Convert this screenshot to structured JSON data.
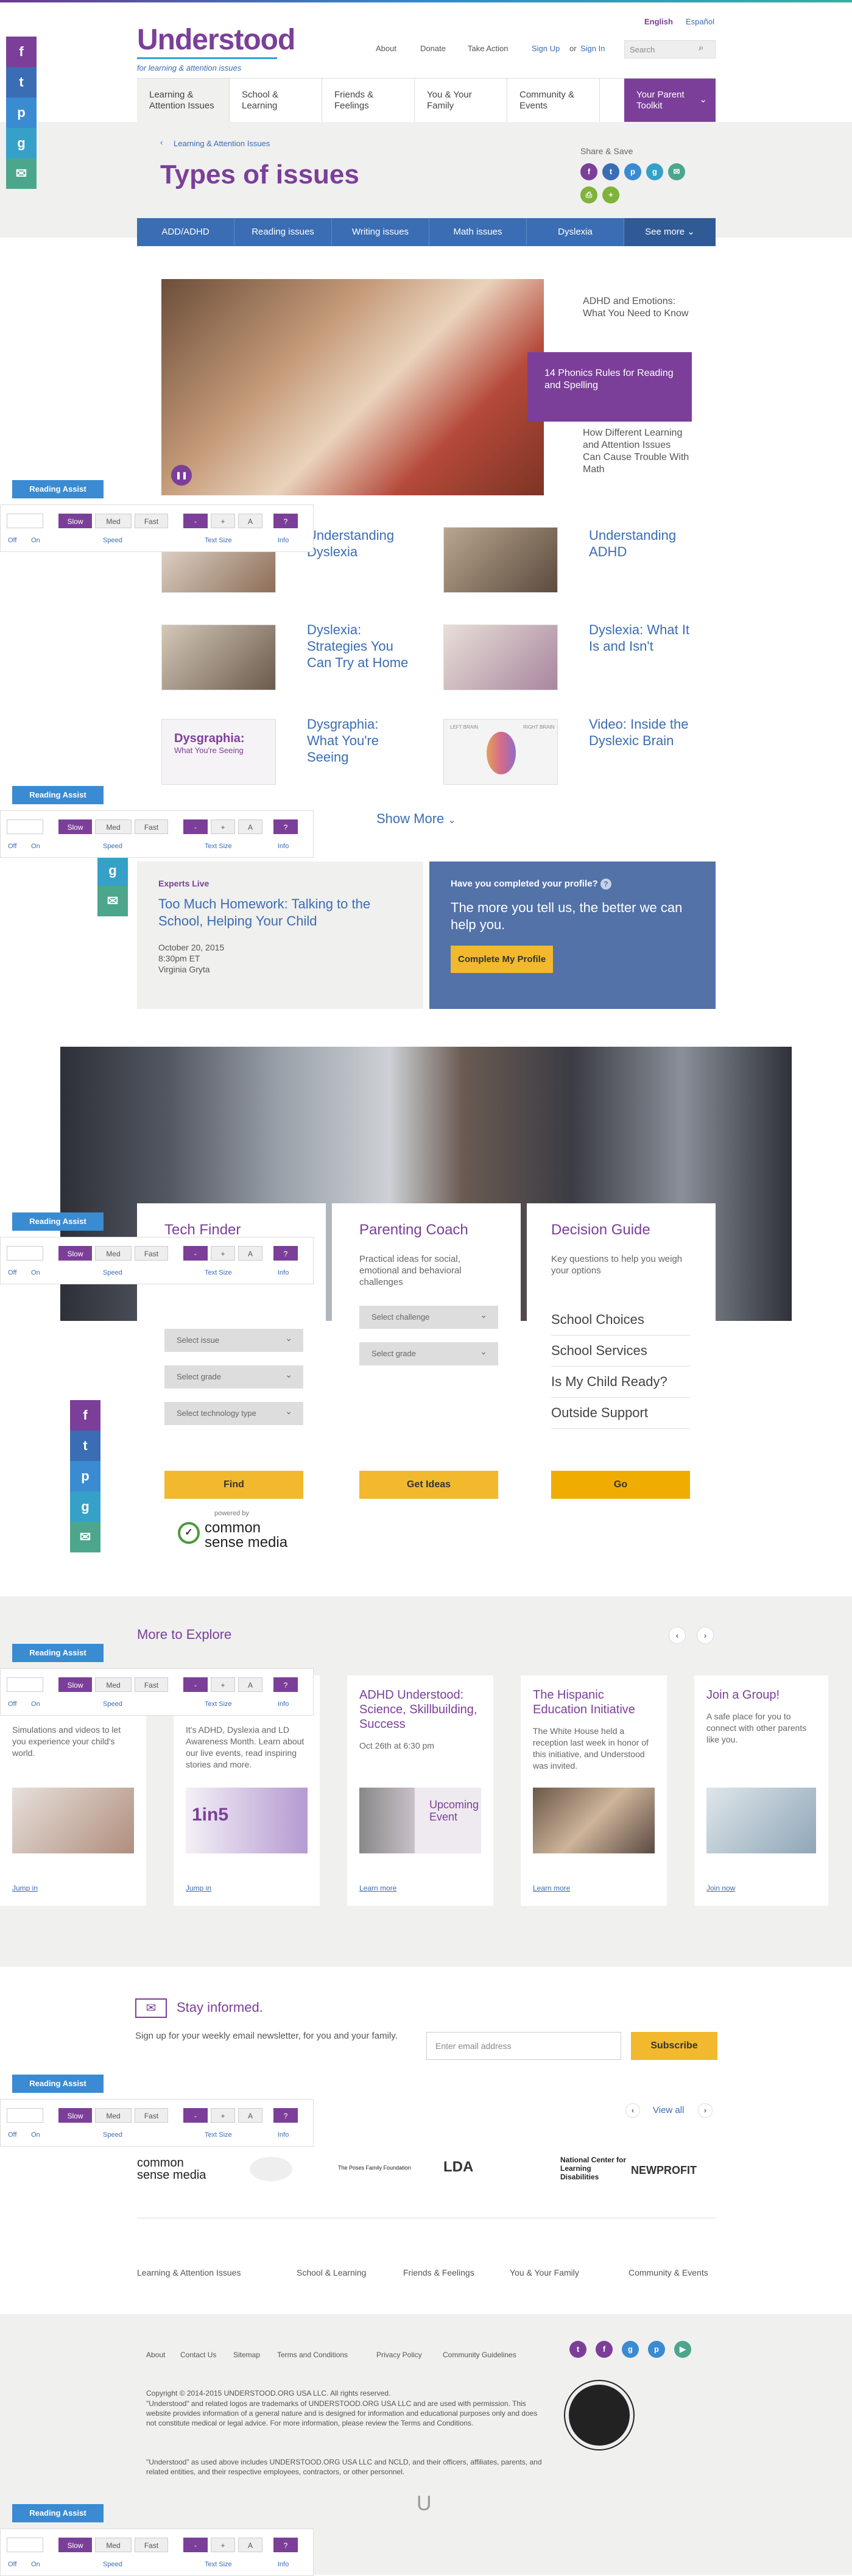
{
  "header": {
    "logo": "Understood",
    "tagline": "for learning & attention issues",
    "lang_en": "English",
    "lang_es": "Español",
    "links": [
      "About",
      "Donate",
      "Take Action"
    ],
    "signup": "Sign Up",
    "or": "or",
    "signin": "Sign In",
    "search_placeholder": "Search"
  },
  "nav": {
    "items": [
      "Learning & Attention Issues",
      "School & Learning",
      "Friends & Feelings",
      "You & Your Family",
      "Community & Events"
    ],
    "toolkit": "Your Parent Toolkit"
  },
  "page": {
    "breadcrumb": "Learning & Attention Issues",
    "title": "Types of issues",
    "share_label": "Share & Save"
  },
  "tabs": [
    "ADD/ADHD",
    "Reading issues",
    "Writing issues",
    "Math issues",
    "Dyslexia",
    "See more"
  ],
  "feature": {
    "side": [
      "ADHD and Emotions: What You Need to Know",
      "14 Phonics Rules for Reading and Spelling",
      "How Different Learning and Attention Issues Can Cause Trouble With Math"
    ]
  },
  "cards": [
    "Understanding Dyslexia",
    "Understanding ADHD",
    "Dyslexia: Strategies You Can Try at Home",
    "Dyslexia: What It Is and Isn't",
    "Dysgraphia: What You're Seeing",
    "Video: Inside the Dyslexic Brain"
  ],
  "thumb_text": {
    "dysgraphia": "Dysgraphia:",
    "dysgraphia_sub": "What You're Seeing",
    "left_brain": "LEFT BRAIN",
    "right_brain": "RIGHT BRAIN"
  },
  "show_more": "Show More",
  "reading_assist": {
    "label": "Reading Assist",
    "off": "Off",
    "on": "On",
    "slow": "Slow",
    "med": "Med",
    "fast": "Fast",
    "speed": "Speed",
    "minus": "-",
    "plus": "+",
    "a": "A",
    "textsize": "Text Size",
    "q": "?",
    "info": "Info"
  },
  "experts": {
    "kicker": "Experts Live",
    "title": "Too Much Homework: Talking to the School, Helping Your Child",
    "date": "October 20, 2015",
    "time": "8:30pm ET",
    "host": "Virginia Gryta"
  },
  "profile": {
    "q": "Have you completed your profile?",
    "text": "The more you tell us, the better we can help you.",
    "button": "Complete My Profile"
  },
  "tools": {
    "tech": {
      "title": "Tech Finder",
      "sel1": "Select issue",
      "sel2": "Select grade",
      "sel3": "Select technology type",
      "button": "Find",
      "powered": "powered by",
      "cs": "common sense media"
    },
    "coach": {
      "title": "Parenting Coach",
      "desc": "Practical ideas for social, emotional and behavioral challenges",
      "sel1": "Select challenge",
      "sel2": "Select grade",
      "button": "Get Ideas"
    },
    "guide": {
      "title": "Decision Guide",
      "desc": "Key questions to help you weigh your options",
      "links": [
        "School Choices",
        "School Services",
        "Is My Child Ready?",
        "Outside Support"
      ],
      "button": "Go"
    }
  },
  "more": {
    "title": "More to Explore",
    "cards": [
      {
        "title": "",
        "desc": "Simulations and videos to let you experience your child's world.",
        "link": "Jump in"
      },
      {
        "title": "",
        "desc": "It's ADHD, Dyslexia and LD Awareness Month. Learn about our live events, read inspiring stories and more.",
        "link": "Jump in",
        "img": "1in5"
      },
      {
        "title": "ADHD Understood: Science, Skillbuilding, Success",
        "desc": "Oct 26th at 6:30 pm",
        "link": "Learn more",
        "img": "Upcoming Event"
      },
      {
        "title": "The Hispanic Education Initiative",
        "desc": "The White House held a reception last week in honor of this initiative, and Understood was invited.",
        "link": "Learn more"
      },
      {
        "title": "Join a Group!",
        "desc": "A safe place for you to connect with other parents like you.",
        "link": "Join now"
      }
    ]
  },
  "newsletter": {
    "title": "Stay informed.",
    "text": "Sign up for your weekly email newsletter, for you and your family.",
    "placeholder": "Enter email address",
    "button": "Subscribe",
    "view_all": "View all"
  },
  "partners": [
    "common sense media",
    "",
    "The Poses Family Foundation",
    "LDA",
    "National Center for Learning Disabilities",
    "NEWPROFIT"
  ],
  "footer": {
    "links": [
      "Learning & Attention Issues",
      "School & Learning",
      "Friends & Feelings",
      "You & Your Family",
      "Community & Events"
    ],
    "small_links": [
      "About",
      "Contact Us",
      "Sitemap",
      "Terms and Conditions",
      "Privacy Policy",
      "Community Guidelines"
    ],
    "copy1": "Copyright © 2014-2015 UNDERSTOOD.ORG USA LLC. All rights reserved.",
    "copy2": "\"Understood\" and related logos are trademarks of UNDERSTOOD.ORG USA LLC and are used with permission. This website provides information of a general nature and is designed for information and educational purposes only and does not constitute medical or legal advice. For more information, please review the Terms and Conditions.",
    "copy3": "\"Understood\" as used above includes UNDERSTOOD.ORG USA LLC and NCLD, and their officers, affiliates, parents, and related entities, and their respective employees, contractors, or other personnel."
  }
}
